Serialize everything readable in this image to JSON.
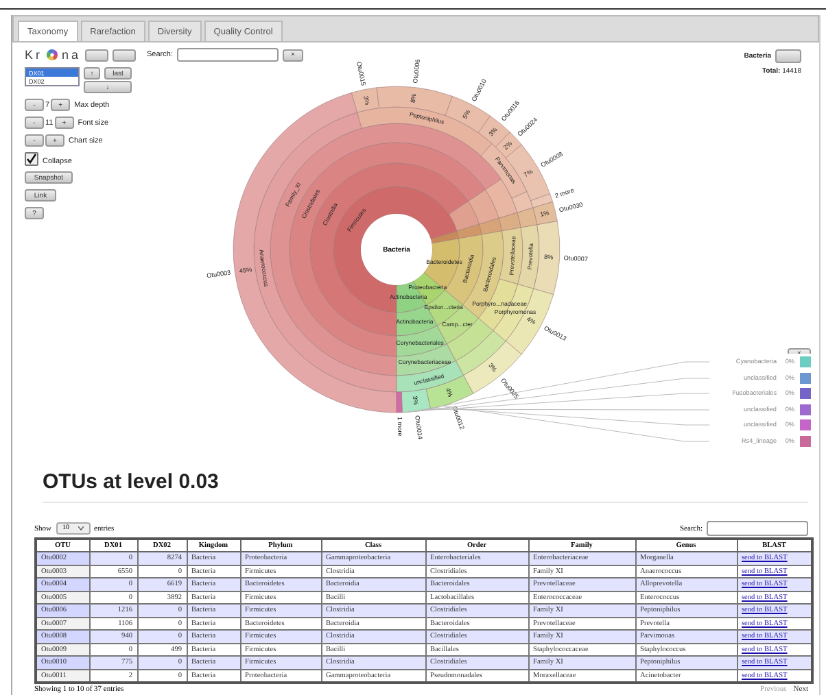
{
  "tabs": [
    {
      "label": "Taxonomy",
      "selected": true
    },
    {
      "label": "Rarefaction",
      "selected": false
    },
    {
      "label": "Diversity",
      "selected": false
    },
    {
      "label": "Quality Control",
      "selected": false
    }
  ],
  "krona": {
    "logo": {
      "left": "Kr",
      "right": "na"
    },
    "search": {
      "label": "Search:",
      "clear": "×"
    },
    "datasets": [
      {
        "label": "DX01",
        "selected": true
      },
      {
        "label": "DX02",
        "selected": false
      }
    ],
    "dataset_buttons": [
      "↑",
      "last",
      "↓"
    ],
    "steppers": [
      {
        "minus": "-",
        "value": "7",
        "plus": "+",
        "label": "Max depth"
      },
      {
        "minus": "-",
        "value": "11",
        "plus": "+",
        "label": "Font size"
      },
      {
        "minus": "-",
        "plus": "+",
        "label": "Chart size"
      }
    ],
    "collapse": {
      "label": "Collapse",
      "checked": true
    },
    "buttons": [
      "Snapshot",
      "Link",
      "?"
    ],
    "focus": "Bacteria",
    "total": {
      "label": "Total:",
      "value": "14418"
    },
    "sunburst": {
      "center": "Bacteria",
      "rings": [
        {
          "segments": [
            {
              "label": "Firmicutes"
            },
            {
              "label": "Bacteroidetes"
            },
            {
              "label": "Proteobacteria"
            },
            {
              "label": "Actinobacteria"
            }
          ]
        },
        {
          "segments": [
            {
              "label": "Clostridia"
            },
            {
              "label": "Bacteroidia"
            },
            {
              "label": "Epsilon...cteria"
            },
            {
              "label": "Actinobacteria"
            }
          ]
        },
        {
          "segments": [
            {
              "label": "Clostridiales"
            },
            {
              "label": "Bacteroidales"
            },
            {
              "label": "Camp...cter"
            },
            {
              "label": "Corynebacteriales"
            }
          ]
        },
        {
          "segments": [
            {
              "label": "Family_XI"
            },
            {
              "label": "Prevotellaceae"
            },
            {
              "label": "Porphyro...nadaceae"
            },
            {
              "label": "Corynebacteriaceae"
            }
          ]
        },
        {
          "segments": [
            {
              "label": "Anaerococcus"
            },
            {
              "label": "Peptoniphilus"
            },
            {
              "label": "Parvimonas"
            },
            {
              "label": "Prevotella"
            },
            {
              "label": "Porphyromonas"
            },
            {
              "label": "unclassified"
            }
          ]
        },
        {
          "segments": [
            {
              "label": "Otu0003",
              "percent": "45%"
            },
            {
              "label": "Otu0015",
              "percent": "3%"
            },
            {
              "label": "Otu0006",
              "percent": "8%"
            },
            {
              "label": "Otu0010",
              "percent": "5%"
            },
            {
              "label": "Otu0016",
              "percent": "3%"
            },
            {
              "label": "Otu0024",
              "percent": "2%"
            },
            {
              "label": "Otu0008",
              "percent": "7%"
            },
            {
              "label": "2 more"
            },
            {
              "label": "Otu0030",
              "percent": "1%"
            },
            {
              "label": "Otu0007",
              "percent": "8%"
            },
            {
              "label": "Otu0013",
              "percent": "4%"
            },
            {
              "label": "Otu0025",
              "percent": "3%"
            },
            {
              "label": "Otu0012",
              "percent": "4%"
            },
            {
              "label": "Otu0014",
              "percent": "3%"
            },
            {
              "label": "1 more"
            }
          ]
        }
      ]
    },
    "legend": {
      "toggle": "×",
      "items": [
        {
          "label": "Cyanobacteria",
          "percent": "0%",
          "color": "#6ccdc2"
        },
        {
          "label": "unclassified",
          "percent": "0%",
          "color": "#6b96d0"
        },
        {
          "label": "Fusobacteriales",
          "percent": "0%",
          "color": "#7464c8"
        },
        {
          "label": "unclassified",
          "percent": "0%",
          "color": "#9e6ad0"
        },
        {
          "label": "unclassified",
          "percent": "0%",
          "color": "#c466c8"
        },
        {
          "label": "Rs4_lineage",
          "percent": "0%",
          "color": "#c86a9a"
        }
      ]
    }
  },
  "otu_section": {
    "heading": "OTUs at level 0.03",
    "length": {
      "show": "Show",
      "value": "10",
      "entries": "entries"
    },
    "search": {
      "label": "Search:"
    },
    "columns": [
      "OTU",
      "DX01",
      "DX02",
      "Kingdom",
      "Phylum",
      "Class",
      "Order",
      "Family",
      "Genus",
      "BLAST"
    ],
    "rows": [
      [
        "Otu0002",
        "0",
        "8274",
        "Bacteria",
        "Proteobacteria",
        "Gammaproteobacteria",
        "Enterobacteriales",
        "Enterobacteriaceae",
        "Morganella",
        "send to BLAST"
      ],
      [
        "Otu0003",
        "6550",
        "0",
        "Bacteria",
        "Firmicutes",
        "Clostridia",
        "Clostridiales",
        "Family XI",
        "Anaerococcus",
        "send to BLAST"
      ],
      [
        "Otu0004",
        "0",
        "6619",
        "Bacteria",
        "Bacteroidetes",
        "Bacteroidia",
        "Bacteroidales",
        "Prevotellaceae",
        "Alloprevotella",
        "send to BLAST"
      ],
      [
        "Otu0005",
        "0",
        "3892",
        "Bacteria",
        "Firmicutes",
        "Bacilli",
        "Lactobacillales",
        "Enterococcaceae",
        "Enterococcus",
        "send to BLAST"
      ],
      [
        "Otu0006",
        "1216",
        "0",
        "Bacteria",
        "Firmicutes",
        "Clostridia",
        "Clostridiales",
        "Family XI",
        "Peptoniphilus",
        "send to BLAST"
      ],
      [
        "Otu0007",
        "1106",
        "0",
        "Bacteria",
        "Bacteroidetes",
        "Bacteroidia",
        "Bacteroidales",
        "Prevotellaceae",
        "Prevotella",
        "send to BLAST"
      ],
      [
        "Otu0008",
        "940",
        "0",
        "Bacteria",
        "Firmicutes",
        "Clostridia",
        "Clostridiales",
        "Family XI",
        "Parvimonas",
        "send to BLAST"
      ],
      [
        "Otu0009",
        "0",
        "499",
        "Bacteria",
        "Firmicutes",
        "Bacilli",
        "Bacillales",
        "Staphylococcaceae",
        "Staphylococcus",
        "send to BLAST"
      ],
      [
        "Otu0010",
        "775",
        "0",
        "Bacteria",
        "Firmicutes",
        "Clostridia",
        "Clostridiales",
        "Family XI",
        "Peptoniphilus",
        "send to BLAST"
      ],
      [
        "Otu0011",
        "2",
        "0",
        "Bacteria",
        "Proteobacteria",
        "Gammaproteobacteria",
        "Pseudomonadales",
        "Moraxellaceae",
        "Acinetobacter",
        "send to BLAST"
      ]
    ],
    "info": "Showing 1 to 10 of 37 entries",
    "pager": [
      {
        "label": "Previous",
        "disabled": true
      },
      {
        "label": "Next",
        "disabled": false
      }
    ]
  }
}
